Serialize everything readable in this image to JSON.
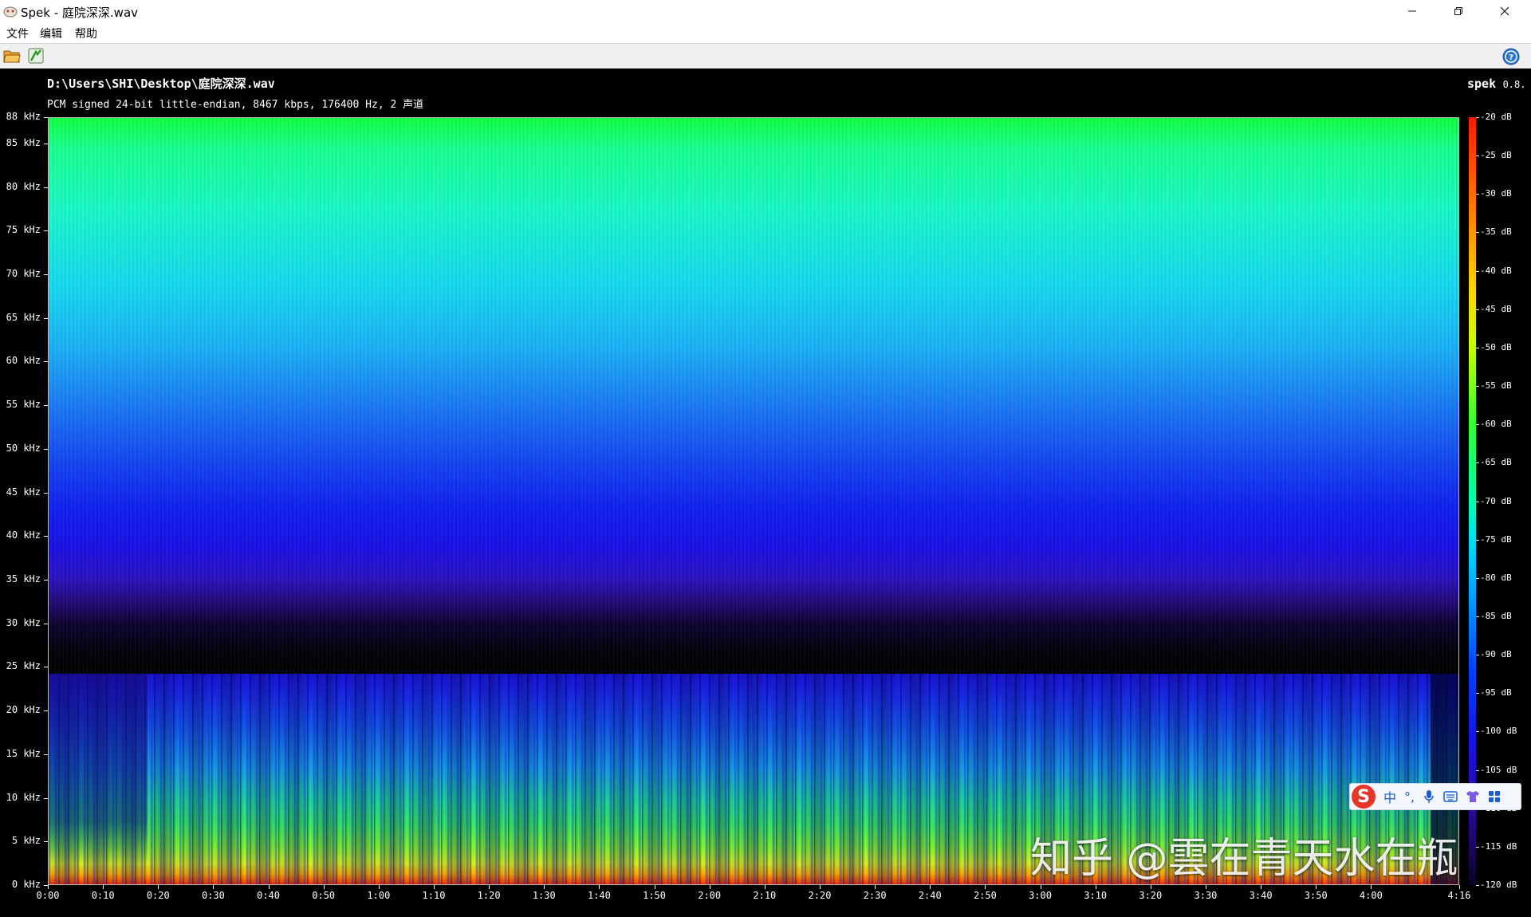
{
  "window": {
    "title": "Spek - 庭院深深.wav",
    "buttons": {
      "minimize": "minimize-icon",
      "maximize": "maximize-icon",
      "close": "close-icon"
    }
  },
  "menu": {
    "file": "文件",
    "edit": "编辑",
    "help": "帮助"
  },
  "toolbar": {
    "open": "folder-open-icon",
    "preferences": "preferences-icon",
    "help": "help-icon"
  },
  "spectrogram": {
    "file_path": "D:\\Users\\SHI\\Desktop\\庭院深深.wav",
    "file_info": "PCM signed 24-bit little-endian, 8467 kbps, 176400 Hz, 2 声道",
    "brand_name": "spek",
    "brand_version": "0.8.",
    "freq_labels": [
      "88 kHz",
      "85 kHz",
      "80 kHz",
      "75 kHz",
      "70 kHz",
      "65 kHz",
      "60 kHz",
      "55 kHz",
      "50 kHz",
      "45 kHz",
      "40 kHz",
      "35 kHz",
      "30 kHz",
      "25 kHz",
      "20 kHz",
      "15 kHz",
      "10 kHz",
      "5 kHz",
      "0 kHz"
    ],
    "time_labels": [
      "0:00",
      "0:10",
      "0:20",
      "0:30",
      "0:40",
      "0:50",
      "1:00",
      "1:10",
      "1:20",
      "1:30",
      "1:40",
      "1:50",
      "2:00",
      "2:10",
      "2:20",
      "2:30",
      "2:40",
      "2:50",
      "3:00",
      "3:10",
      "3:20",
      "3:30",
      "3:40",
      "3:50",
      "4:00",
      "4:16"
    ],
    "db_labels": [
      "-20 dB",
      "-25 dB",
      "-30 dB",
      "-35 dB",
      "-40 dB",
      "-45 dB",
      "-50 dB",
      "-55 dB",
      "-60 dB",
      "-65 dB",
      "-70 dB",
      "-75 dB",
      "-80 dB",
      "-85 dB",
      "-90 dB",
      "-95 dB",
      "-100 dB",
      "-105 dB",
      "-110 dB",
      "-115 dB",
      "-120 dB"
    ]
  },
  "ime_bar": {
    "logo": "S",
    "items": [
      "中",
      "°,",
      "microphone-icon",
      "keyboard-icon",
      "skin-icon",
      "toolbox-icon"
    ]
  },
  "watermark": "知乎 @雲在青天水在瓶"
}
